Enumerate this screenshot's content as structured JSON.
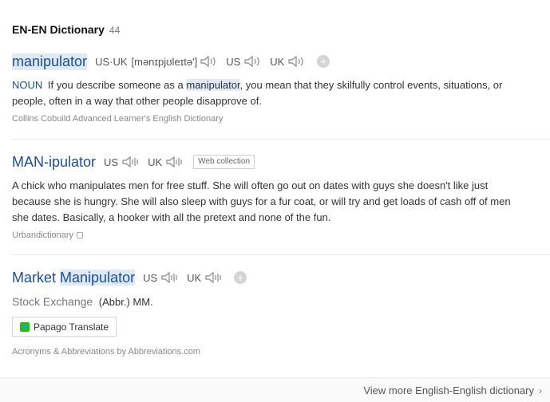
{
  "header": {
    "title": "EN-EN Dictionary",
    "count": "44"
  },
  "entries": [
    {
      "word": "manipulator",
      "us_uk_label": "US·UK",
      "ipa": "[mənɪpjʊleɪtə']",
      "us_label": "US",
      "uk_label": "UK",
      "pos": "NOUN",
      "def_before": "If you describe someone as a",
      "def_highlight": "manipulator",
      "def_after": ", you mean that they skilfully control events, situations, or",
      "def_line2": "people, often in a way that other people disapprove of.",
      "source": "Collins Cobuild Advanced Learner's English Dictionary"
    },
    {
      "word": "MAN-ipulator",
      "us_label": "US",
      "uk_label": "UK",
      "tag": "Web collection",
      "def_line1": "A chick who manipulates men for free stuff. She will often go out on dates with guys she doesn't like just",
      "def_line2": "because she is hungry. She will also sleep with guys for a fur coat, or will try and get loads of cash off of men",
      "def_line3": "she dates. Basically, a hooker with all the pretext and none of the fun.",
      "source": "Urbandictionary"
    },
    {
      "word_part1": "Market",
      "word_part2": "Manipulator",
      "us_label": "US",
      "uk_label": "UK",
      "category": "Stock Exchange",
      "def": "(Abbr.) MM.",
      "papago_label": "Papago Translate",
      "source": "Acronyms & Abbreviations by Abbreviations.com"
    }
  ],
  "footer": {
    "more_label": "View more English-English dictionary",
    "chevron": "›"
  },
  "colors": {
    "link": "#1a4fa0",
    "highlight": "#dfeaf6",
    "papago_green": "#1ec800",
    "papago_blue": "#3a8ee6"
  }
}
